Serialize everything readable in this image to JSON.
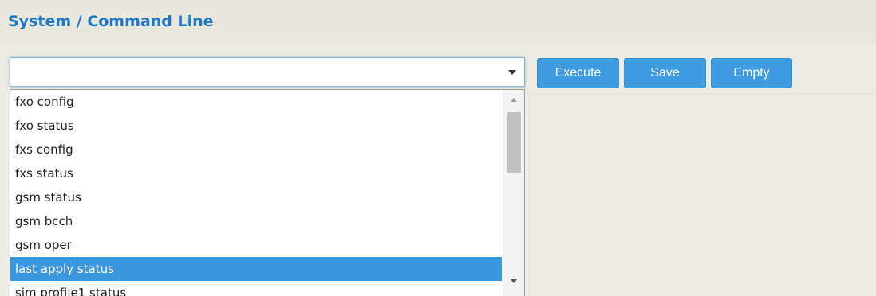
{
  "page": {
    "title": "System / Command Line"
  },
  "command": {
    "value": "",
    "placeholder": ""
  },
  "buttons": {
    "execute": "Execute",
    "save": "Save",
    "empty": "Empty"
  },
  "dropdown": {
    "options": [
      "fxo config",
      "fxo status",
      "fxs config",
      "fxs status",
      "gsm status",
      "gsm bcch",
      "gsm oper",
      "last apply status",
      "sim profile1 status"
    ],
    "selected": "last apply status"
  },
  "colors": {
    "title": "#1e78c8",
    "button": "#3f9be0",
    "selected": "#3b97de",
    "header_bg": "#e8e8dc",
    "content_bg": "#ecece2"
  },
  "icons": {
    "combo_arrow": "chevron-down-icon",
    "scroll_up": "scroll-up-arrow-icon",
    "scroll_down": "scroll-down-arrow-icon"
  }
}
